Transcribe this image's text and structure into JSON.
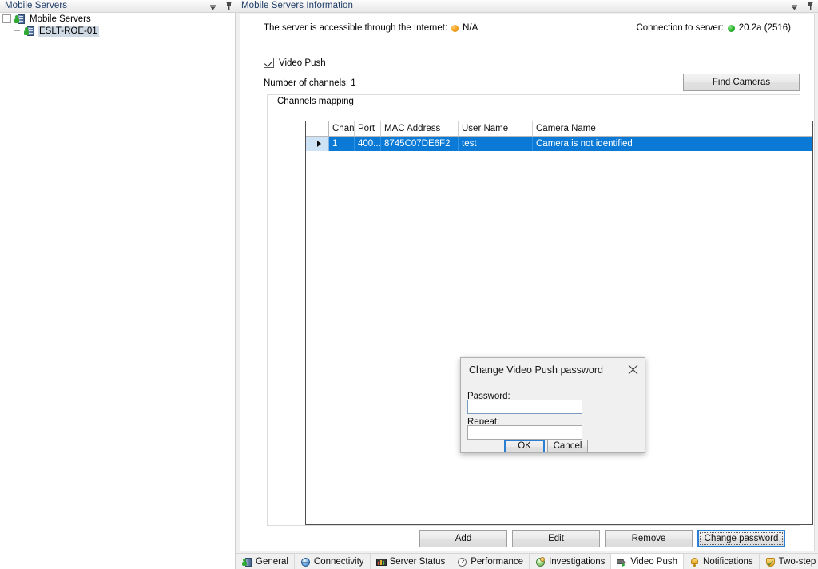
{
  "left_panel": {
    "caption": "Mobile Servers",
    "caption_icons": [
      "chevron-down-icon",
      "pin-icon"
    ],
    "tree": {
      "root_label": "Mobile Servers",
      "child_label": "ESLT-ROE-01",
      "child_selected": true
    }
  },
  "right_panel": {
    "caption": "Mobile Servers Information",
    "caption_icons": [
      "chevron-down-icon",
      "pin-icon"
    ],
    "status": {
      "internet_label": "The server is accessible through the Internet:",
      "internet_value": "N/A",
      "internet_dot_color": "#f5a01a",
      "connection_label": "Connection to server:",
      "connection_value": "20.2a (2516)",
      "connection_dot_color": "#2bb52b"
    },
    "video_push": {
      "checkbox_label": "Video Push",
      "checked": true
    },
    "channels_count_label": "Number of channels: 1",
    "find_cameras_label": "Find Cameras",
    "group_title": "Channels mapping",
    "grid": {
      "columns": [
        "",
        "Chann",
        "Port",
        "MAC Address",
        "User Name",
        "Camera Name"
      ],
      "rows": [
        {
          "indicator": "row-selector-caret",
          "channel": "1",
          "port": "400...",
          "mac": "8745C07DE6F2",
          "user": "test",
          "camera": "Camera is not identified",
          "selected": true
        }
      ]
    },
    "actions": {
      "add": "Add",
      "edit": "Edit",
      "remove": "Remove",
      "change_password": "Change password",
      "focused": "change_password"
    }
  },
  "dialog": {
    "title": "Change Video Push password",
    "close_icon": "close-icon",
    "password_label": "Password:",
    "password_value": "",
    "repeat_label": "Repeat:",
    "repeat_value": "",
    "ok_label": "OK",
    "cancel_label": "Cancel",
    "default_button": "OK"
  },
  "tabs": [
    {
      "label": "General",
      "icon": "server-person-icon",
      "active": false
    },
    {
      "label": "Connectivity",
      "icon": "globe-icon",
      "active": false
    },
    {
      "label": "Server Status",
      "icon": "monitor-bars-icon",
      "active": false
    },
    {
      "label": "Performance",
      "icon": "gauge-icon",
      "active": false
    },
    {
      "label": "Investigations",
      "icon": "spheres-icon",
      "active": false
    },
    {
      "label": "Video Push",
      "icon": "camera-push-icon",
      "active": true
    },
    {
      "label": "Notifications",
      "icon": "bell-icon",
      "active": false
    },
    {
      "label": "Two-step verification",
      "icon": "shield-check-icon",
      "active": false
    }
  ]
}
